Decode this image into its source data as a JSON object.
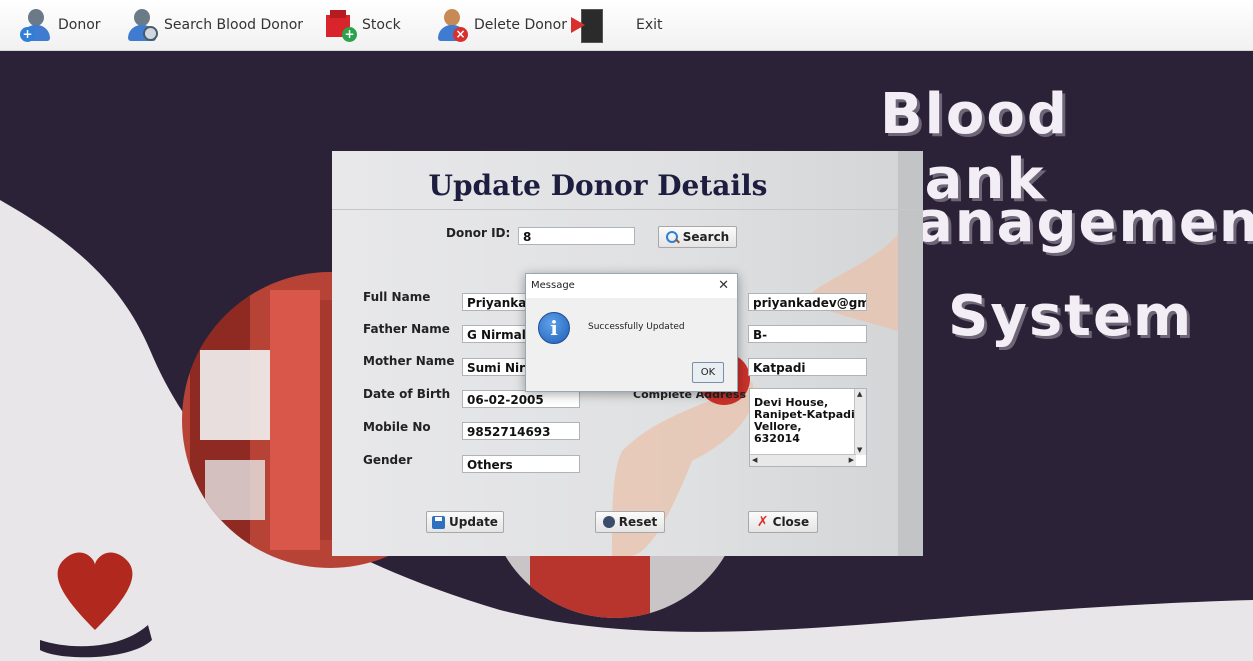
{
  "menu": {
    "items": [
      {
        "label": "Donor",
        "icon": "add-donor-icon"
      },
      {
        "label": "Search Blood Donor",
        "icon": "search-donor-icon"
      },
      {
        "label": "Stock",
        "icon": "stock-icon"
      },
      {
        "label": "Delete Donor",
        "icon": "delete-donor-icon"
      },
      {
        "label": "Exit",
        "icon": "exit-icon"
      }
    ]
  },
  "background": {
    "title_lines": [
      "Blood Bank",
      "anagement",
      "System"
    ]
  },
  "form": {
    "title": "Update Donor Details",
    "donor_id_label": "Donor ID:",
    "donor_id_value": "8",
    "search_button": "Search",
    "fields": {
      "full_name": {
        "label": "Full Name",
        "value": "Priyanka D"
      },
      "father_name": {
        "label": "Father Name",
        "value": "G Nirmal D"
      },
      "mother_name": {
        "label": "Mother Name",
        "value": "Sumi Nirmal"
      },
      "dob": {
        "label": "Date of Birth",
        "value": "06-02-2005"
      },
      "mobile": {
        "label": "Mobile No",
        "value": "9852714693"
      },
      "gender": {
        "label": "Gender",
        "value": "Others"
      },
      "email": {
        "value": "priyankadev@gmai"
      },
      "blood_group": {
        "value": "B-"
      },
      "city": {
        "value": "Katpadi"
      },
      "address": {
        "label": "Complete Address",
        "value": "Devi House,\nRanipet-Katpadi\nVellore,\n632014"
      }
    },
    "buttons": {
      "update": "Update",
      "reset": "Reset",
      "close": "Close"
    }
  },
  "dialog": {
    "title": "Message",
    "message": "Successfully Updated",
    "ok_label": "OK",
    "close_glyph": "✕",
    "icon": "info-icon"
  },
  "colors": {
    "background_dark": "#2b2238",
    "title_text": "#f3eef6",
    "form_title": "#1d1e3f",
    "heart": "#b0281e"
  }
}
